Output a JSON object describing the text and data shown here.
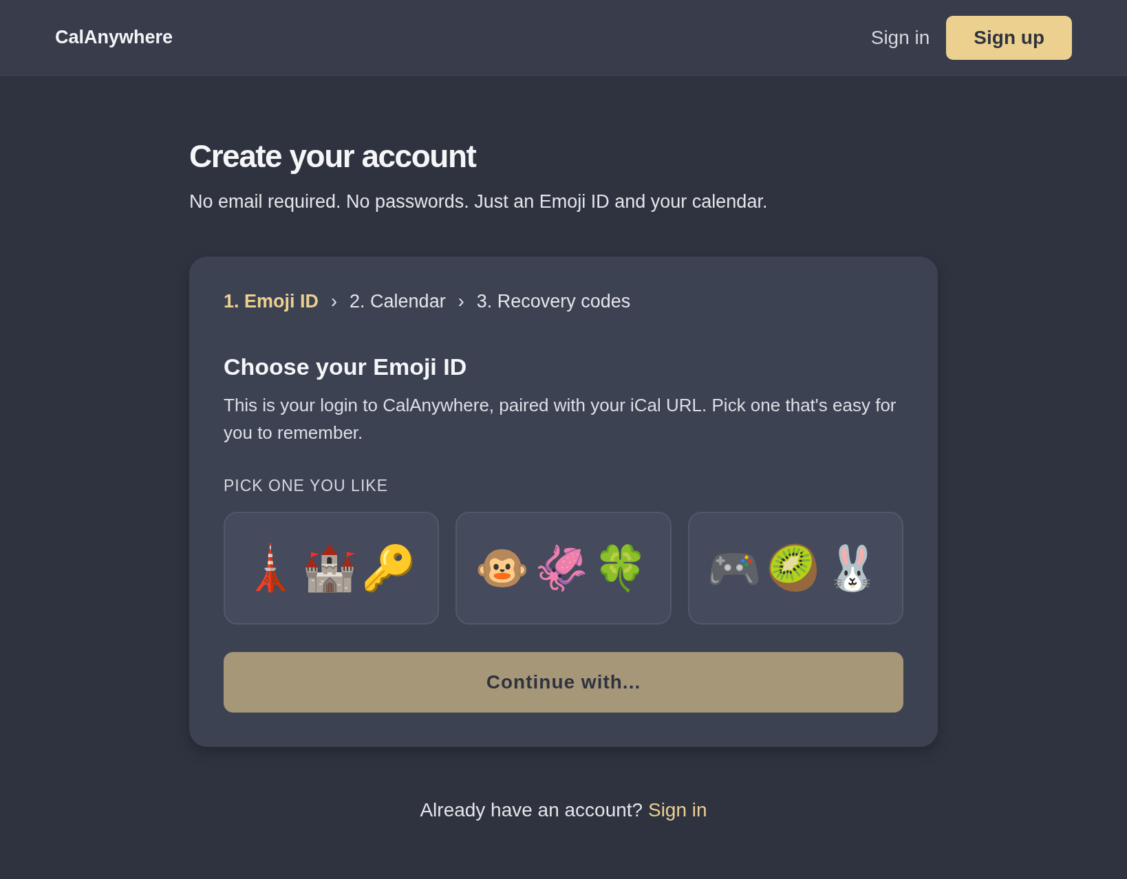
{
  "header": {
    "brand": "CalAnywhere",
    "sign_in": "Sign in",
    "sign_up": "Sign up"
  },
  "page": {
    "title": "Create your account",
    "subtitle": "No email required. No passwords. Just an Emoji ID and your calendar."
  },
  "steps": [
    {
      "label": "1. Emoji ID",
      "selected": true
    },
    {
      "label": "2. Calendar",
      "selected": false
    },
    {
      "label": "3. Recovery codes",
      "selected": false
    }
  ],
  "step_separator": "›",
  "section": {
    "title": "Choose your Emoji ID",
    "description": "This is your login to CalAnywhere, paired with your iCal URL. Pick one that's easy for you to remember.",
    "pick_label": "PICK ONE YOU LIKE"
  },
  "options": [
    {
      "emoji": "🗼🏰🔑",
      "selected": false
    },
    {
      "emoji": "🐵🦑🍀",
      "selected": false
    },
    {
      "emoji": "🎮🥝🐰",
      "selected": false
    }
  ],
  "continue_button": {
    "label": "Continue with...",
    "disabled": true
  },
  "footer": {
    "text": "Already have an account?",
    "link": "Sign in"
  }
}
